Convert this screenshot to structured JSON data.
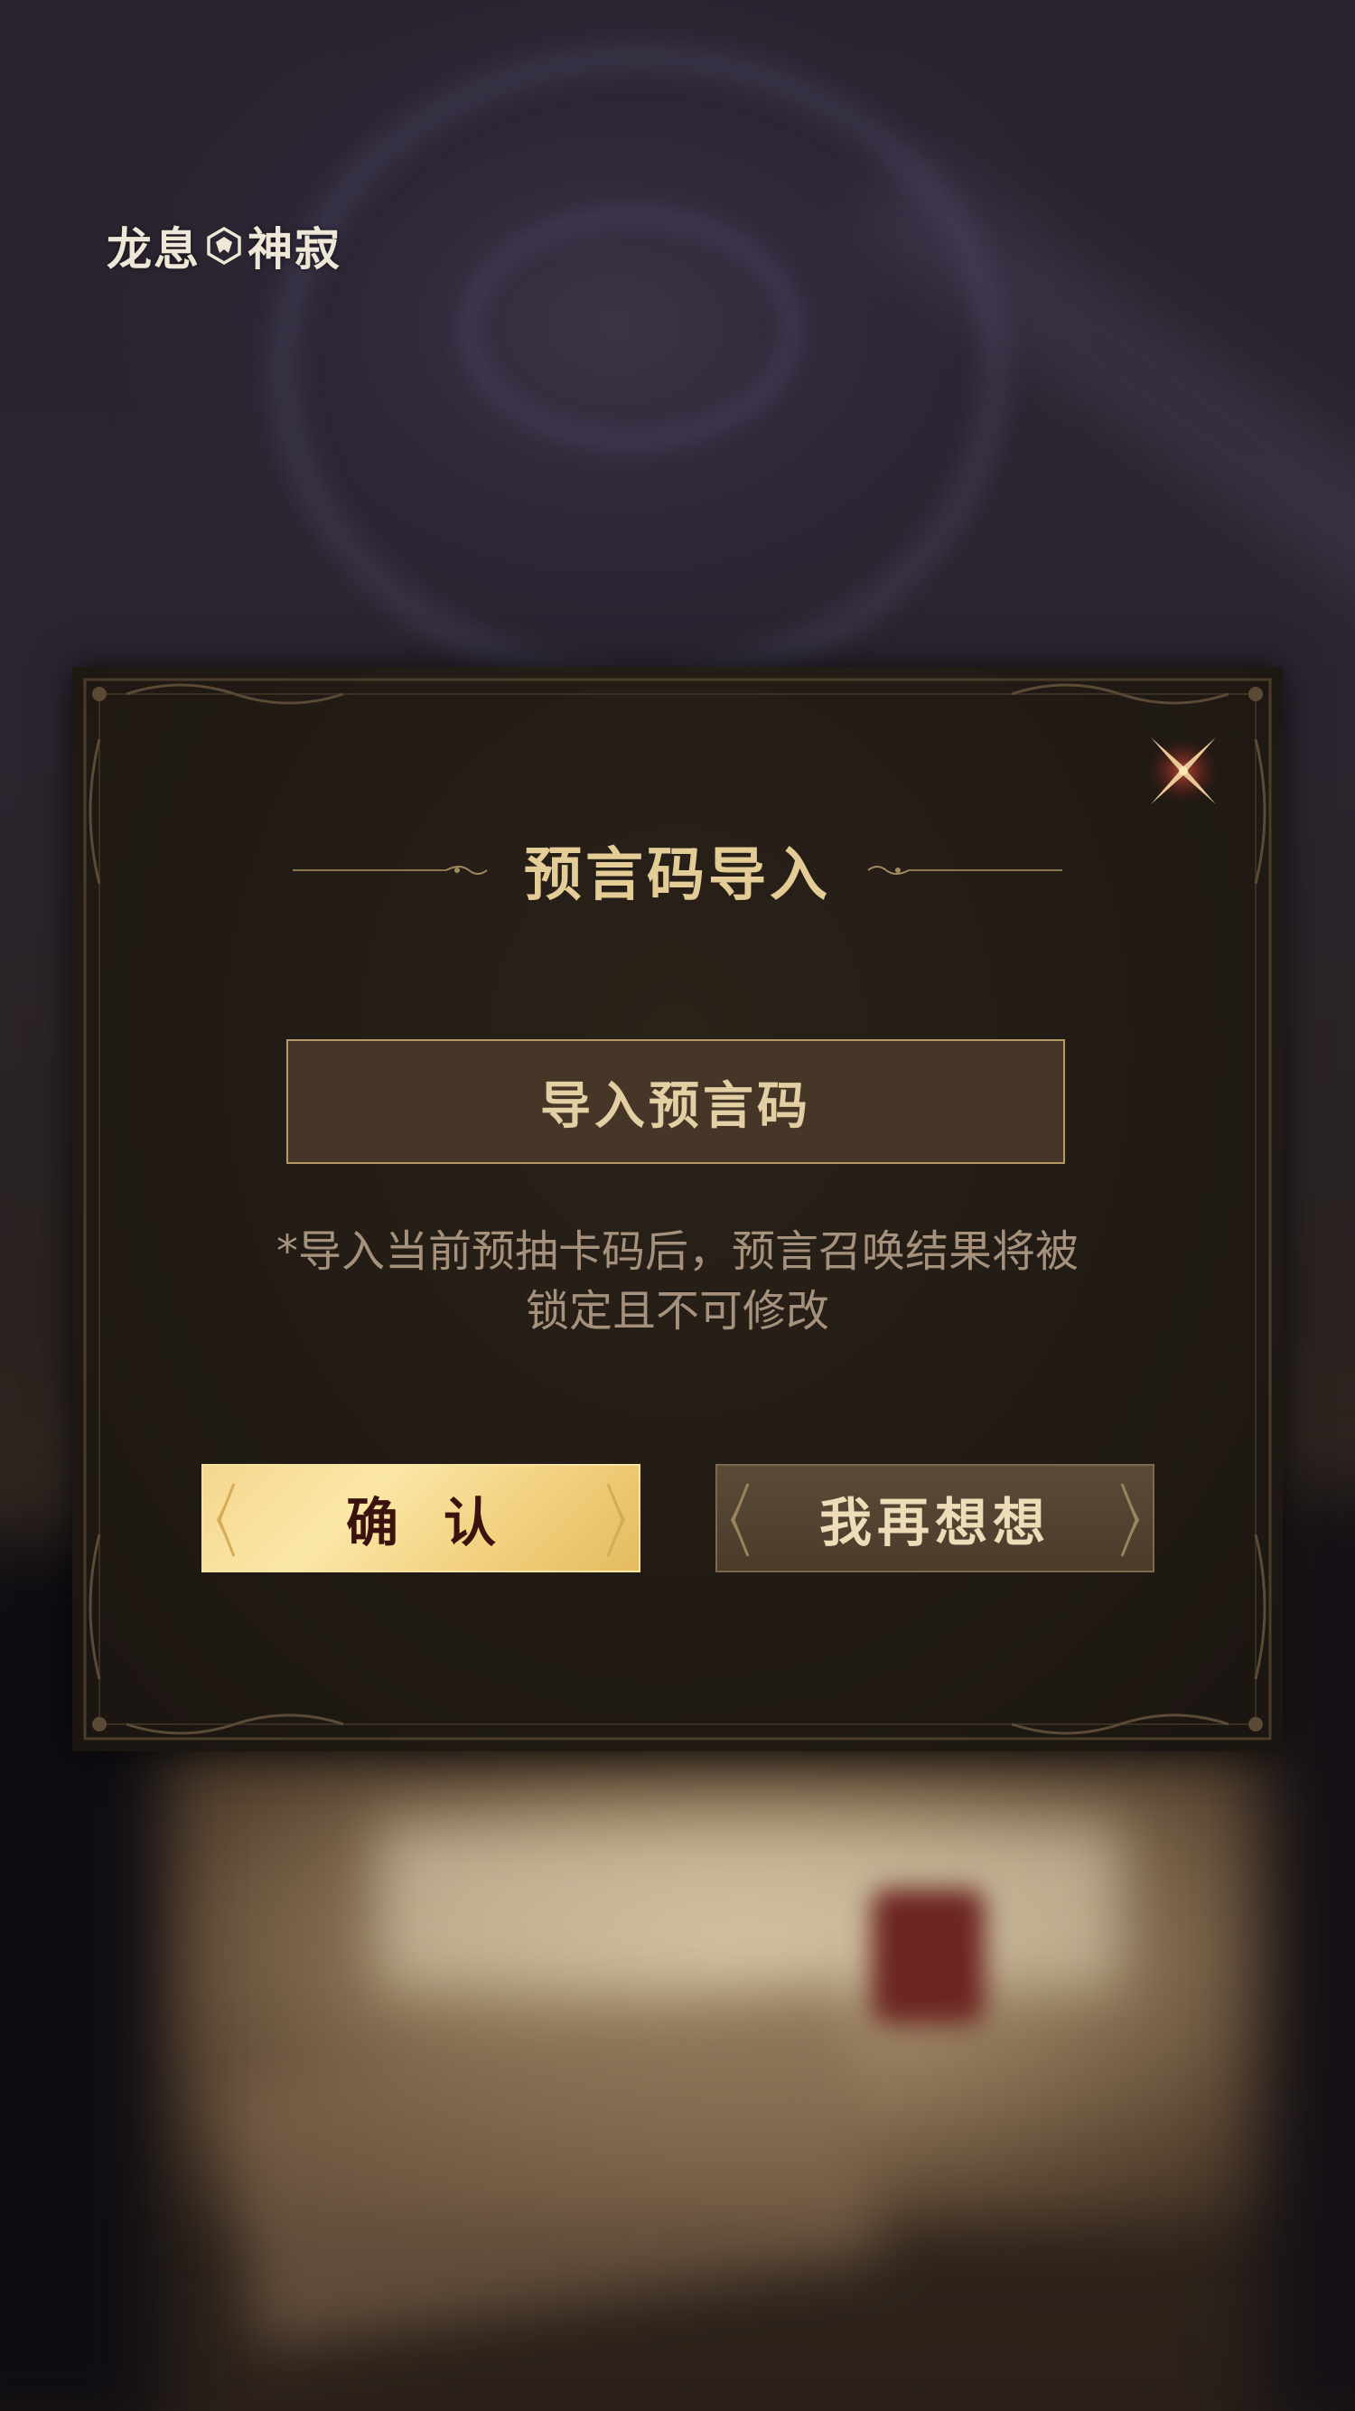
{
  "logo": {
    "text_left": "龙息",
    "text_right": "神寂"
  },
  "dialog": {
    "title": "预言码导入",
    "import_button_label": "导入预言码",
    "notice_line1": "*导入当前预抽卡码后，预言召唤结果将被",
    "notice_line2": "锁定且不可修改",
    "confirm_label": "确认",
    "rethink_label": "我再想想"
  },
  "colors": {
    "accent_gold": "#e3cc95",
    "confirm_bg": "#f4d78e",
    "panel_bg": "#221b15",
    "close_red": "#a23a2c"
  },
  "icons": {
    "close": "close-x-icon",
    "logo_emblem": "dragon-emblem-icon"
  }
}
